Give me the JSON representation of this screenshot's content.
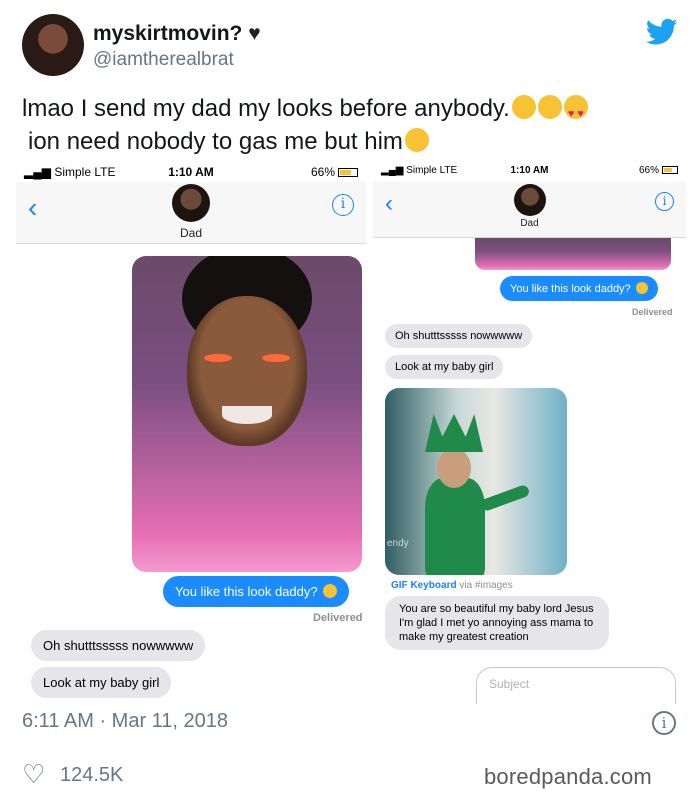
{
  "tweet": {
    "display_name": "myskirtmovin?",
    "handle": "@iamtherealbrat",
    "text_line1": "lmao I send my dad my looks before anybody.",
    "text_line2": "ion need nobody to gas me but him",
    "timestamp": "6:11 AM · Mar 11, 2018",
    "likes": "124.5K",
    "watermark": "boredpanda.com"
  },
  "left_phone": {
    "carrier": "Simple  LTE",
    "time": "1:10 AM",
    "battery": "66%",
    "contact": "Dad",
    "out_msg": "You like this look daddy?",
    "delivered": "Delivered",
    "in_msg1": "Oh shutttsssss nowwwww",
    "in_msg2": "Look at my baby girl"
  },
  "right_phone": {
    "carrier": "Simple  LTE",
    "time": "1:10 AM",
    "battery": "66%",
    "contact": "Dad",
    "out_msg": "You like this look daddy?",
    "delivered": "Delivered",
    "in_msg1": "Oh shutttsssss nowwwww",
    "in_msg2": "Look at my baby girl",
    "gif_source": "GIF Keyboard",
    "gif_via": "via #images",
    "gif_watermark": "endy",
    "in_msg3": "You are so beautiful my baby lord Jesus I'm glad I met yo annoying ass mama to make my greatest creation",
    "subject_placeholder": "Subject"
  },
  "colors": {
    "twitter_blue": "#1da1f2",
    "imessage_blue": "#1a8cff",
    "bubble_gray": "#e5e5ea",
    "meta_gray": "#657786"
  }
}
